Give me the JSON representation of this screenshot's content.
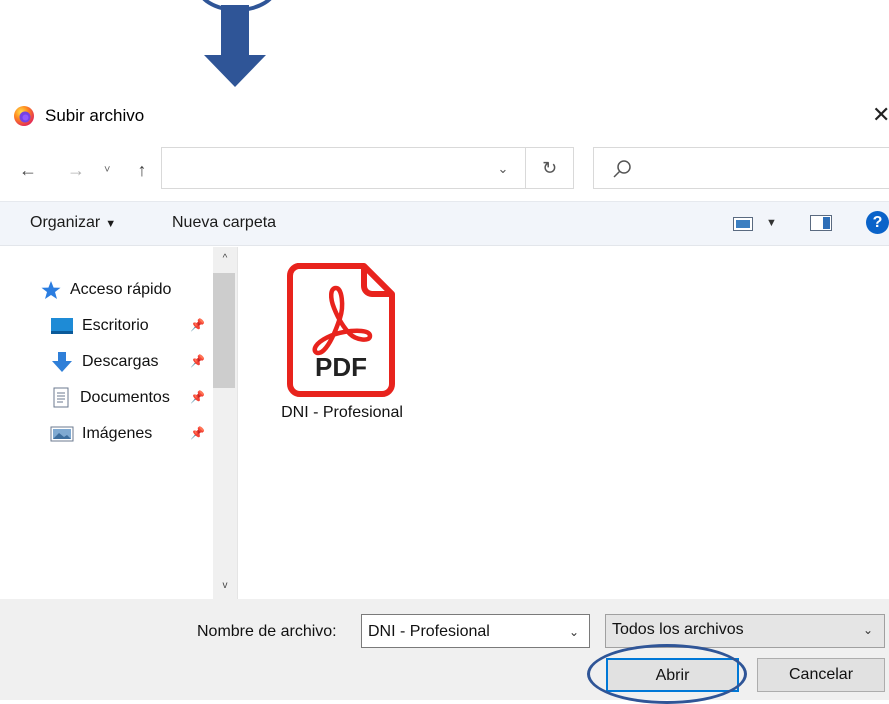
{
  "window": {
    "title": "Subir archivo",
    "close_glyph": "✕",
    "app_icon": "firefox-icon"
  },
  "nav": {
    "back_glyph": "←",
    "forward_glyph": "→",
    "recent_glyph": "˅",
    "up_glyph": "↑",
    "address_value": "",
    "address_dropdown_glyph": "⌄",
    "refresh_glyph": "↻",
    "search_placeholder": ""
  },
  "toolbar": {
    "organize_label": "Organizar",
    "organize_caret": "▼",
    "new_folder_label": "Nueva carpeta",
    "view_caret": "▼",
    "help_glyph": "?"
  },
  "sidebar": {
    "quick_access": "Acceso rápido",
    "items": [
      {
        "label": "Escritorio",
        "icon": "desktop-icon"
      },
      {
        "label": "Descargas",
        "icon": "download-icon"
      },
      {
        "label": "Documentos",
        "icon": "document-icon"
      },
      {
        "label": "Imágenes",
        "icon": "pictures-icon"
      }
    ],
    "pin_glyph": "📌",
    "scroll_up_glyph": "^",
    "scroll_down_glyph": "v"
  },
  "content": {
    "files": [
      {
        "name": "DNI - Profesional",
        "type_label": "PDF",
        "icon": "pdf-file-icon"
      }
    ]
  },
  "bottom": {
    "filename_label": "Nombre de archivo:",
    "filename_value": "DNI - Profesional",
    "filetype_value": "Todos los archivos",
    "caret_glyph": "⌄",
    "open_label": "Abrir",
    "cancel_label": "Cancelar"
  },
  "colors": {
    "accent": "#0078d7",
    "annotation": "#2f5597",
    "pdf_red": "#e8231d",
    "toolbar_bg": "#f2f5fa",
    "bottom_bg": "#f0f0f0"
  }
}
